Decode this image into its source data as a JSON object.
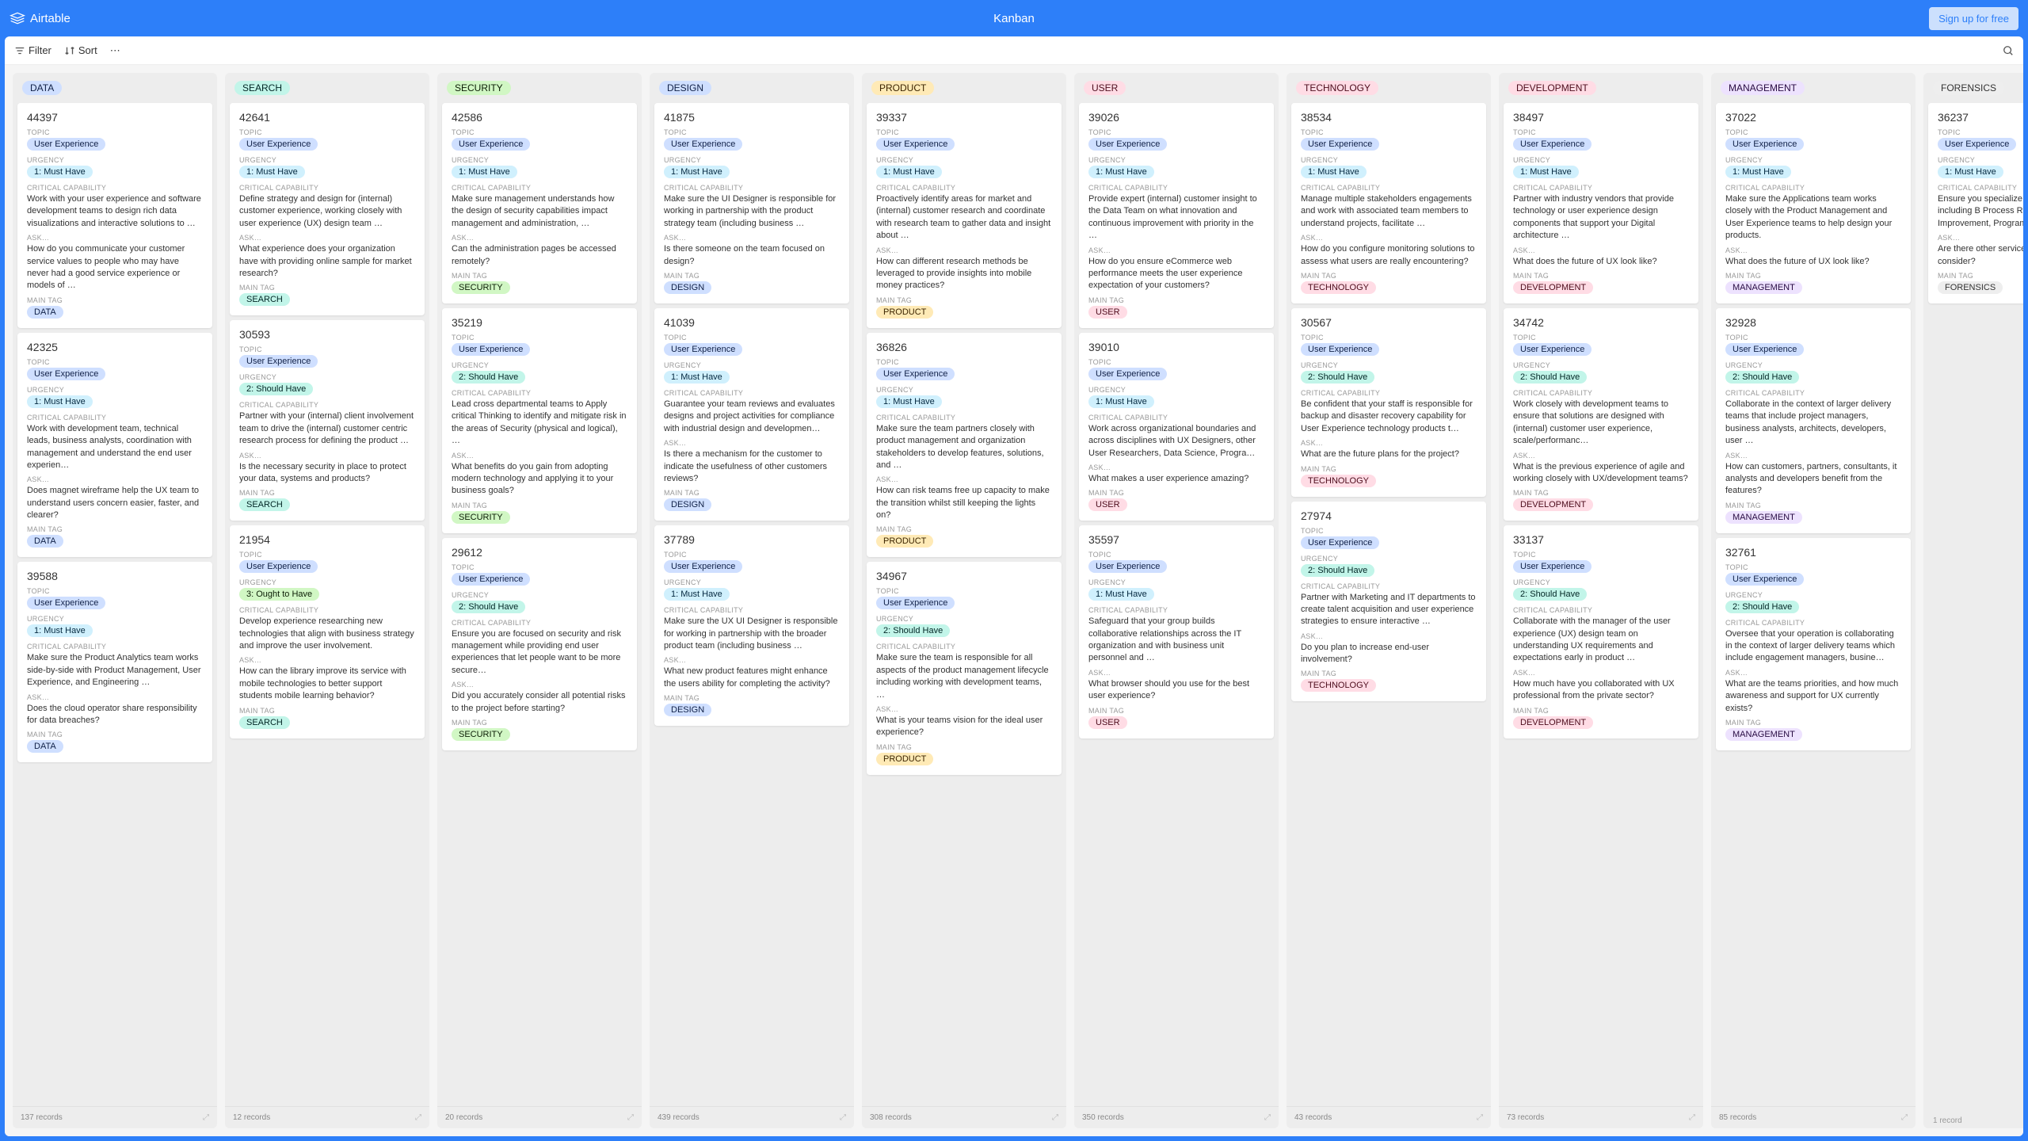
{
  "header": {
    "brand": "Airtable",
    "title": "Kanban",
    "signup": "Sign up for free"
  },
  "toolbar": {
    "filter": "Filter",
    "sort": "Sort"
  },
  "labels": {
    "topic": "TOPIC",
    "urgency": "URGENCY",
    "critcap": "CRITICAL CAPABILITY",
    "ask": "ASK…",
    "maintag": "MAIN TAG",
    "topic_val": "User Experience"
  },
  "urgency": {
    "must": "1: Must Have",
    "should": "2: Should Have",
    "ought": "3: Ought to Have"
  },
  "columns": [
    {
      "name": "DATA",
      "color": "#cfdfff",
      "text": "#102046",
      "footer": "137 records",
      "simple": false,
      "cards": [
        {
          "id": "44397",
          "urg": "must",
          "cap": "Work with your user experience and software development teams to design rich data visualizations and interactive solutions to …",
          "ask": "How do you communicate your customer service values to people who may have never had a good service experience or models of …",
          "tag": "DATA"
        },
        {
          "id": "42325",
          "urg": "must",
          "cap": "Work with development team, technical leads, business analysts, coordination with management and understand the end user experien…",
          "ask": "Does magnet wireframe help the UX team to understand users concern easier, faster, and clearer?",
          "tag": "DATA"
        },
        {
          "id": "39588",
          "urg": "must",
          "cap": "Make sure the Product Analytics team works side-by-side with Product Management, User Experience, and Engineering …",
          "ask": "Does the cloud operator share responsibility for data breaches?",
          "tag": "DATA"
        }
      ]
    },
    {
      "name": "SEARCH",
      "color": "#c2f5e9",
      "text": "#012524",
      "footer": "12 records",
      "simple": false,
      "cards": [
        {
          "id": "42641",
          "urg": "must",
          "cap": "Define strategy and design for (internal) customer experience, working closely with user experience (UX) design team …",
          "ask": "What experience does your organization have with providing online sample for market research?",
          "tag": "SEARCH"
        },
        {
          "id": "30593",
          "urg": "should",
          "cap": "Partner with your (internal) client involvement team to drive the (internal) customer centric research process for defining the product …",
          "ask": "Is the necessary security in place to protect your data, systems and products?",
          "tag": "SEARCH"
        },
        {
          "id": "21954",
          "urg": "ought",
          "cap": "Develop experience researching new technologies that align with business strategy and improve the user involvement.",
          "ask": "How can the library improve its service with mobile technologies to better support students mobile learning behavior?",
          "tag": "SEARCH"
        }
      ]
    },
    {
      "name": "SECURITY",
      "color": "#d1f7c4",
      "text": "#0b1d05",
      "footer": "20 records",
      "simple": false,
      "cards": [
        {
          "id": "42586",
          "urg": "must",
          "cap": "Make sure management understands how the design of security capabilities impact management and administration, …",
          "ask": "Can the administration pages be accessed remotely?",
          "tag": "SECURITY"
        },
        {
          "id": "35219",
          "urg": "should",
          "cap": "Lead cross departmental teams to Apply critical Thinking to identify and mitigate risk in the areas of Security (physical and logical), …",
          "ask": "What benefits do you gain from adopting modern technology and applying it to your business goals?",
          "tag": "SECURITY"
        },
        {
          "id": "29612",
          "urg": "should",
          "cap": "Ensure you are focused on security and risk management while providing end user experiences that let people want to be more secure…",
          "ask": "Did you accurately consider all potential risks to the project before starting?",
          "tag": "SECURITY"
        }
      ]
    },
    {
      "name": "DESIGN",
      "color": "#cfdfff",
      "text": "#102046",
      "footer": "439 records",
      "simple": false,
      "cards": [
        {
          "id": "41875",
          "urg": "must",
          "cap": "Make sure the UI Designer is responsible for working in partnership with the product strategy team (including business …",
          "ask": "Is there someone on the team focused on design?",
          "tag": "DESIGN"
        },
        {
          "id": "41039",
          "urg": "must",
          "cap": "Guarantee your team reviews and evaluates designs and project activities for compliance with industrial design and developmen…",
          "ask": "Is there a mechanism for the customer to indicate the usefulness of other customers reviews?",
          "tag": "DESIGN"
        },
        {
          "id": "37789",
          "urg": "must",
          "cap": "Make sure the UX UI Designer is responsible for working in partnership with the broader product team (including business …",
          "ask": "What new product features might enhance the users ability for completing the activity?",
          "tag": "DESIGN"
        }
      ]
    },
    {
      "name": "PRODUCT",
      "color": "#ffeab6",
      "text": "#3b2501",
      "footer": "308 records",
      "simple": false,
      "cards": [
        {
          "id": "39337",
          "urg": "must",
          "cap": "Proactively identify areas for market and (internal) customer research and coordinate with research team to gather data and insight about …",
          "ask": "How can different research methods be leveraged to provide insights into mobile money practices?",
          "tag": "PRODUCT"
        },
        {
          "id": "36826",
          "urg": "must",
          "cap": "Make sure the team partners closely with product management and organization stakeholders to develop features, solutions, and …",
          "ask": "How can risk teams free up capacity to make the transition whilst still keeping the lights on?",
          "tag": "PRODUCT"
        },
        {
          "id": "34967",
          "urg": "should",
          "cap": "Make sure the team is responsible for all aspects of the product management lifecycle including working with development teams, …",
          "ask": "What is your teams vision for the ideal user experience?",
          "tag": "PRODUCT"
        }
      ]
    },
    {
      "name": "USER",
      "color": "#ffdce5",
      "text": "#4c0c1c",
      "footer": "350 records",
      "simple": false,
      "cards": [
        {
          "id": "39026",
          "urg": "must",
          "cap": "Provide expert (internal) customer insight to the Data Team on what innovation and continuous improvement with priority in the …",
          "ask": "How do you ensure eCommerce web performance meets the user experience expectation of your customers?",
          "tag": "USER"
        },
        {
          "id": "39010",
          "urg": "must",
          "cap": "Work across organizational boundaries and across disciplines with UX Designers, other User Researchers, Data Science, Progra…",
          "ask": "What makes a user experience amazing?",
          "tag": "USER"
        },
        {
          "id": "35597",
          "urg": "must",
          "cap": "Safeguard that your group builds collaborative relationships across the IT organization and with business unit personnel and …",
          "ask": "What browser should you use for the best user experience?",
          "tag": "USER"
        }
      ]
    },
    {
      "name": "TECHNOLOGY",
      "color": "#ffdce5",
      "text": "#4c0c1c",
      "footer": "43 records",
      "simple": false,
      "cards": [
        {
          "id": "38534",
          "urg": "must",
          "cap": "Manage multiple stakeholders engagements and work with associated team members to understand projects, facilitate …",
          "ask": "How do you configure monitoring solutions to assess what users are really encountering?",
          "tag": "TECHNOLOGY"
        },
        {
          "id": "30567",
          "urg": "should",
          "cap": "Be confident that your staff is responsible for backup and disaster recovery capability for User Experience technology products t…",
          "ask": "What are the future plans for the project?",
          "tag": "TECHNOLOGY"
        },
        {
          "id": "27974",
          "urg": "should",
          "cap": "Partner with Marketing and IT departments to create talent acquisition and user experience strategies to ensure interactive …",
          "ask": "Do you plan to increase end-user involvement?",
          "tag": "TECHNOLOGY"
        }
      ]
    },
    {
      "name": "DEVELOPMENT",
      "color": "#ffdce5",
      "text": "#4c0c1c",
      "footer": "73 records",
      "simple": false,
      "cards": [
        {
          "id": "38497",
          "urg": "must",
          "cap": "Partner with industry vendors that provide technology or user experience design components that support your Digital architecture …",
          "ask": "What does the future of UX look like?",
          "tag": "DEVELOPMENT"
        },
        {
          "id": "34742",
          "urg": "should",
          "cap": "Work closely with development teams to ensure that solutions are designed with (internal) customer user experience, scale/performanc…",
          "ask": "What is the previous experience of agile and working closely with UX/development teams?",
          "tag": "DEVELOPMENT"
        },
        {
          "id": "33137",
          "urg": "should",
          "cap": "Collaborate with the manager of the user experience (UX) design team on understanding UX requirements and expectations early in product …",
          "ask": "How much have you collaborated with UX professional from the private sector?",
          "tag": "DEVELOPMENT"
        }
      ]
    },
    {
      "name": "MANAGEMENT",
      "color": "#ede2fe",
      "text": "#280b42",
      "footer": "85 records",
      "simple": false,
      "cards": [
        {
          "id": "37022",
          "urg": "must",
          "cap": "Make sure the Applications team works closely with the Product Management and User Experience teams to help design your products.",
          "ask": "What does the future of UX look like?",
          "tag": "MANAGEMENT"
        },
        {
          "id": "32928",
          "urg": "should",
          "cap": "Collaborate in the context of larger delivery teams that include project managers, business analysts, architects, developers, user …",
          "ask": "How can customers, partners, consultants, it analysts and developers benefit from the features?",
          "tag": "MANAGEMENT"
        },
        {
          "id": "32761",
          "urg": "should",
          "cap": "Oversee that your operation is collaborating in the context of larger delivery teams which include engagement managers, busine…",
          "ask": "What are the teams priorities, and how much awareness and support for UX currently exists?",
          "tag": "MANAGEMENT"
        }
      ]
    },
    {
      "name": "FORENSICS",
      "color": "#eee",
      "text": "#333",
      "footer": "",
      "simple": true,
      "sub": "1 record",
      "cards": [
        {
          "id": "36237",
          "urg": "must",
          "cap": "Ensure you specialize in a range of services including B Process Re-engineering and Improvement, Program …",
          "ask": "Are there other services or p you need to consider?",
          "tag": "FORENSICS"
        }
      ]
    }
  ]
}
